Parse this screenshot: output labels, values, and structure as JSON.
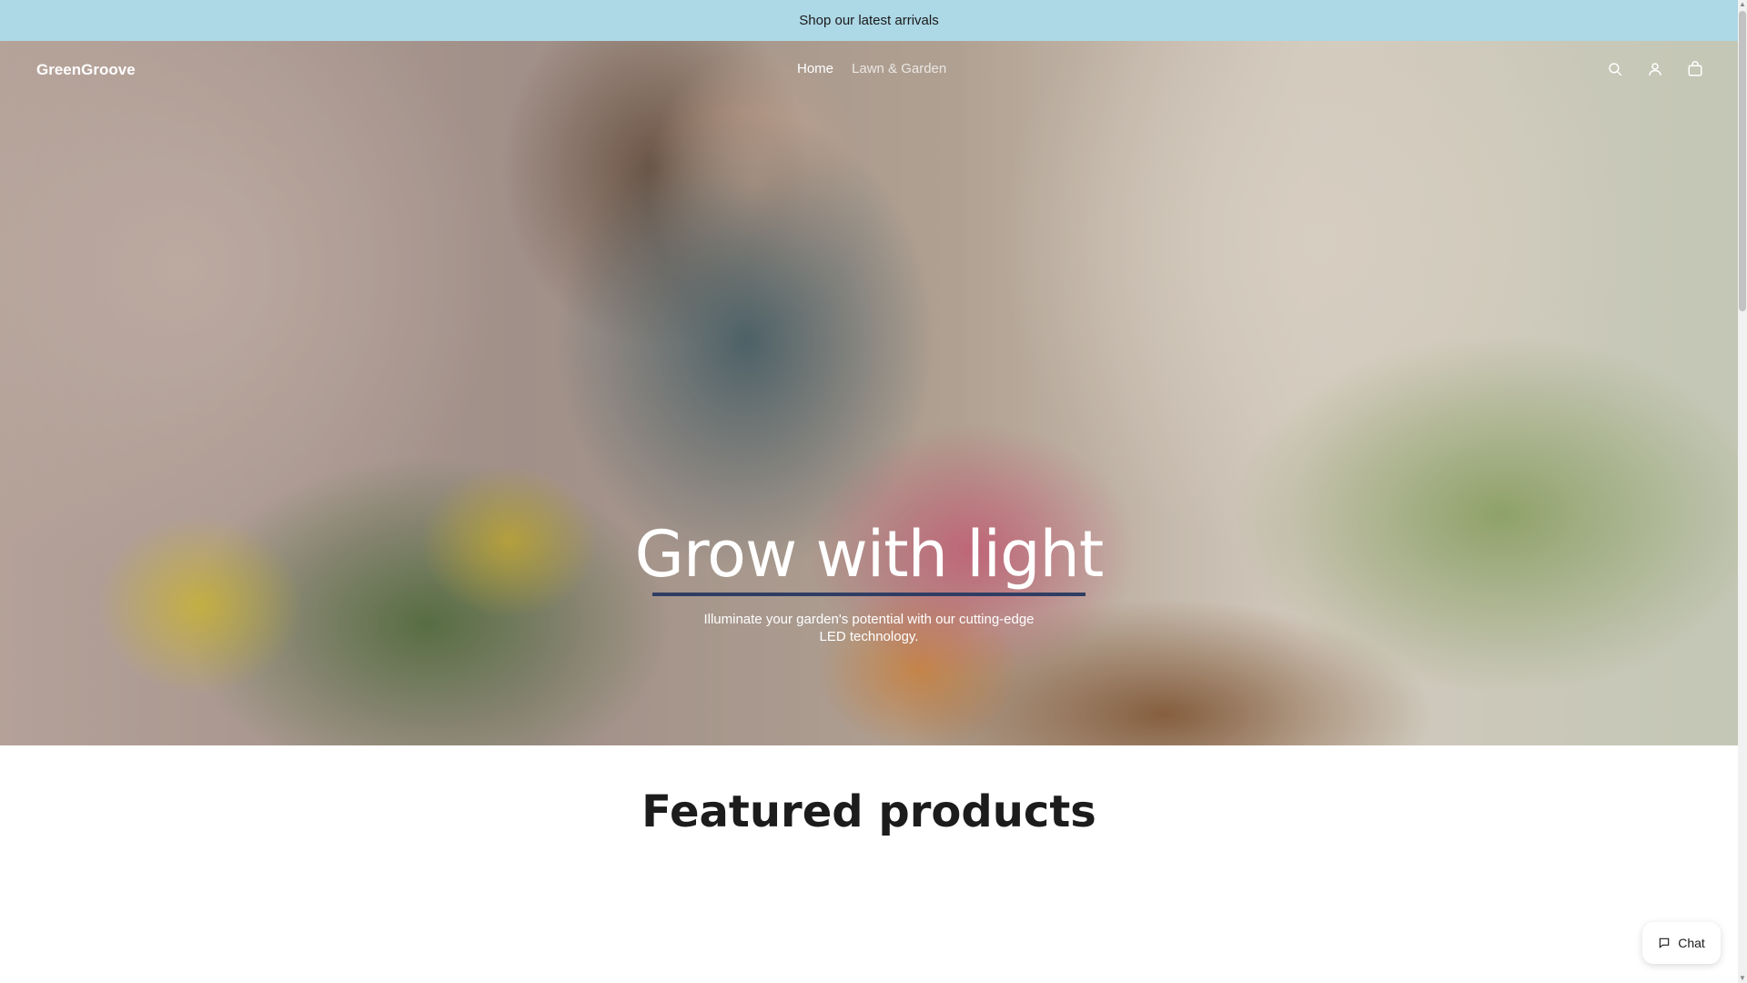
{
  "announcement": {
    "text": "Shop our latest arrivals"
  },
  "header": {
    "logo": "GreenGroove",
    "nav": [
      {
        "label": "Home",
        "active": true
      },
      {
        "label": "Lawn & Garden",
        "active": false
      }
    ],
    "icons": [
      "search-icon",
      "account-icon",
      "cart-icon"
    ]
  },
  "hero": {
    "title": "Grow with light",
    "subtitle": "Illuminate your garden's potential with our cutting-edge LED technology.",
    "image": "woman-planting-flowers-in-wooden-box"
  },
  "featured": {
    "title": "Featured products"
  },
  "chat": {
    "label": "Chat"
  },
  "colors": {
    "announcement_bg": "#add8e6",
    "underline": "#2f3d63"
  }
}
